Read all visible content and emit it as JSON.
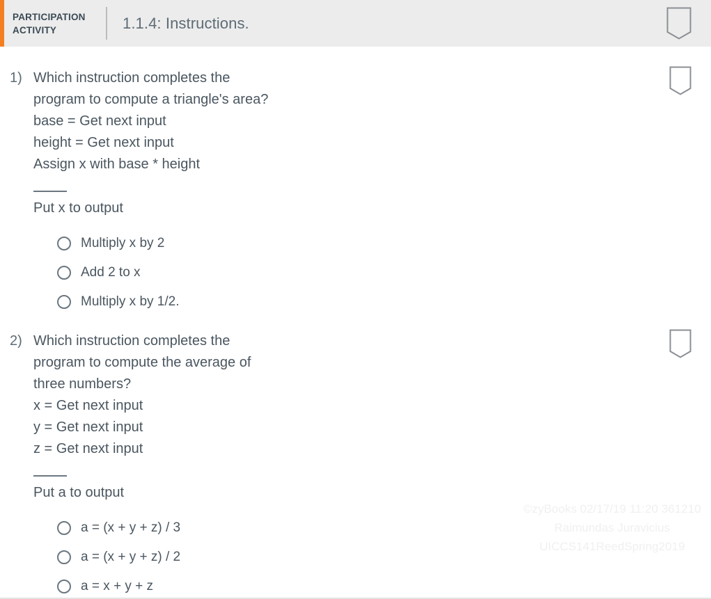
{
  "header": {
    "label": "PARTICIPATION ACTIVITY",
    "label_line1": "PARTICIPATION",
    "label_line2": "ACTIVITY",
    "title": "1.1.4: Instructions.",
    "accent_color": "#f47f20",
    "background_color": "#ececec",
    "bookmark_icon": "pennant-icon"
  },
  "questions": [
    {
      "number": "1)",
      "prompt": "Which instruction completes the\nprogram to compute a triangle's area?",
      "code_before": "base = Get next input\nheight = Get next input\nAssign x with base * height",
      "blank": "____",
      "code_after": "Put x to output",
      "choices": [
        "Multiply x by 2",
        "Add 2 to x",
        "Multiply x by 1/2."
      ]
    },
    {
      "number": "2)",
      "prompt": "Which instruction completes the\nprogram to compute the average of\nthree numbers?",
      "code_before": "x = Get next input\ny = Get next input\nz = Get next input",
      "blank": "____",
      "code_after": "Put a to output",
      "choices": [
        "a = (x + y + z) / 3",
        "a = (x + y + z) / 2",
        "a = x + y + z"
      ]
    }
  ],
  "watermark": {
    "line1": "©zyBooks 02/17/19 11:20 361210",
    "line2": "Raimundas Juravicius",
    "line3": "UICCS141ReedSpring2019"
  }
}
